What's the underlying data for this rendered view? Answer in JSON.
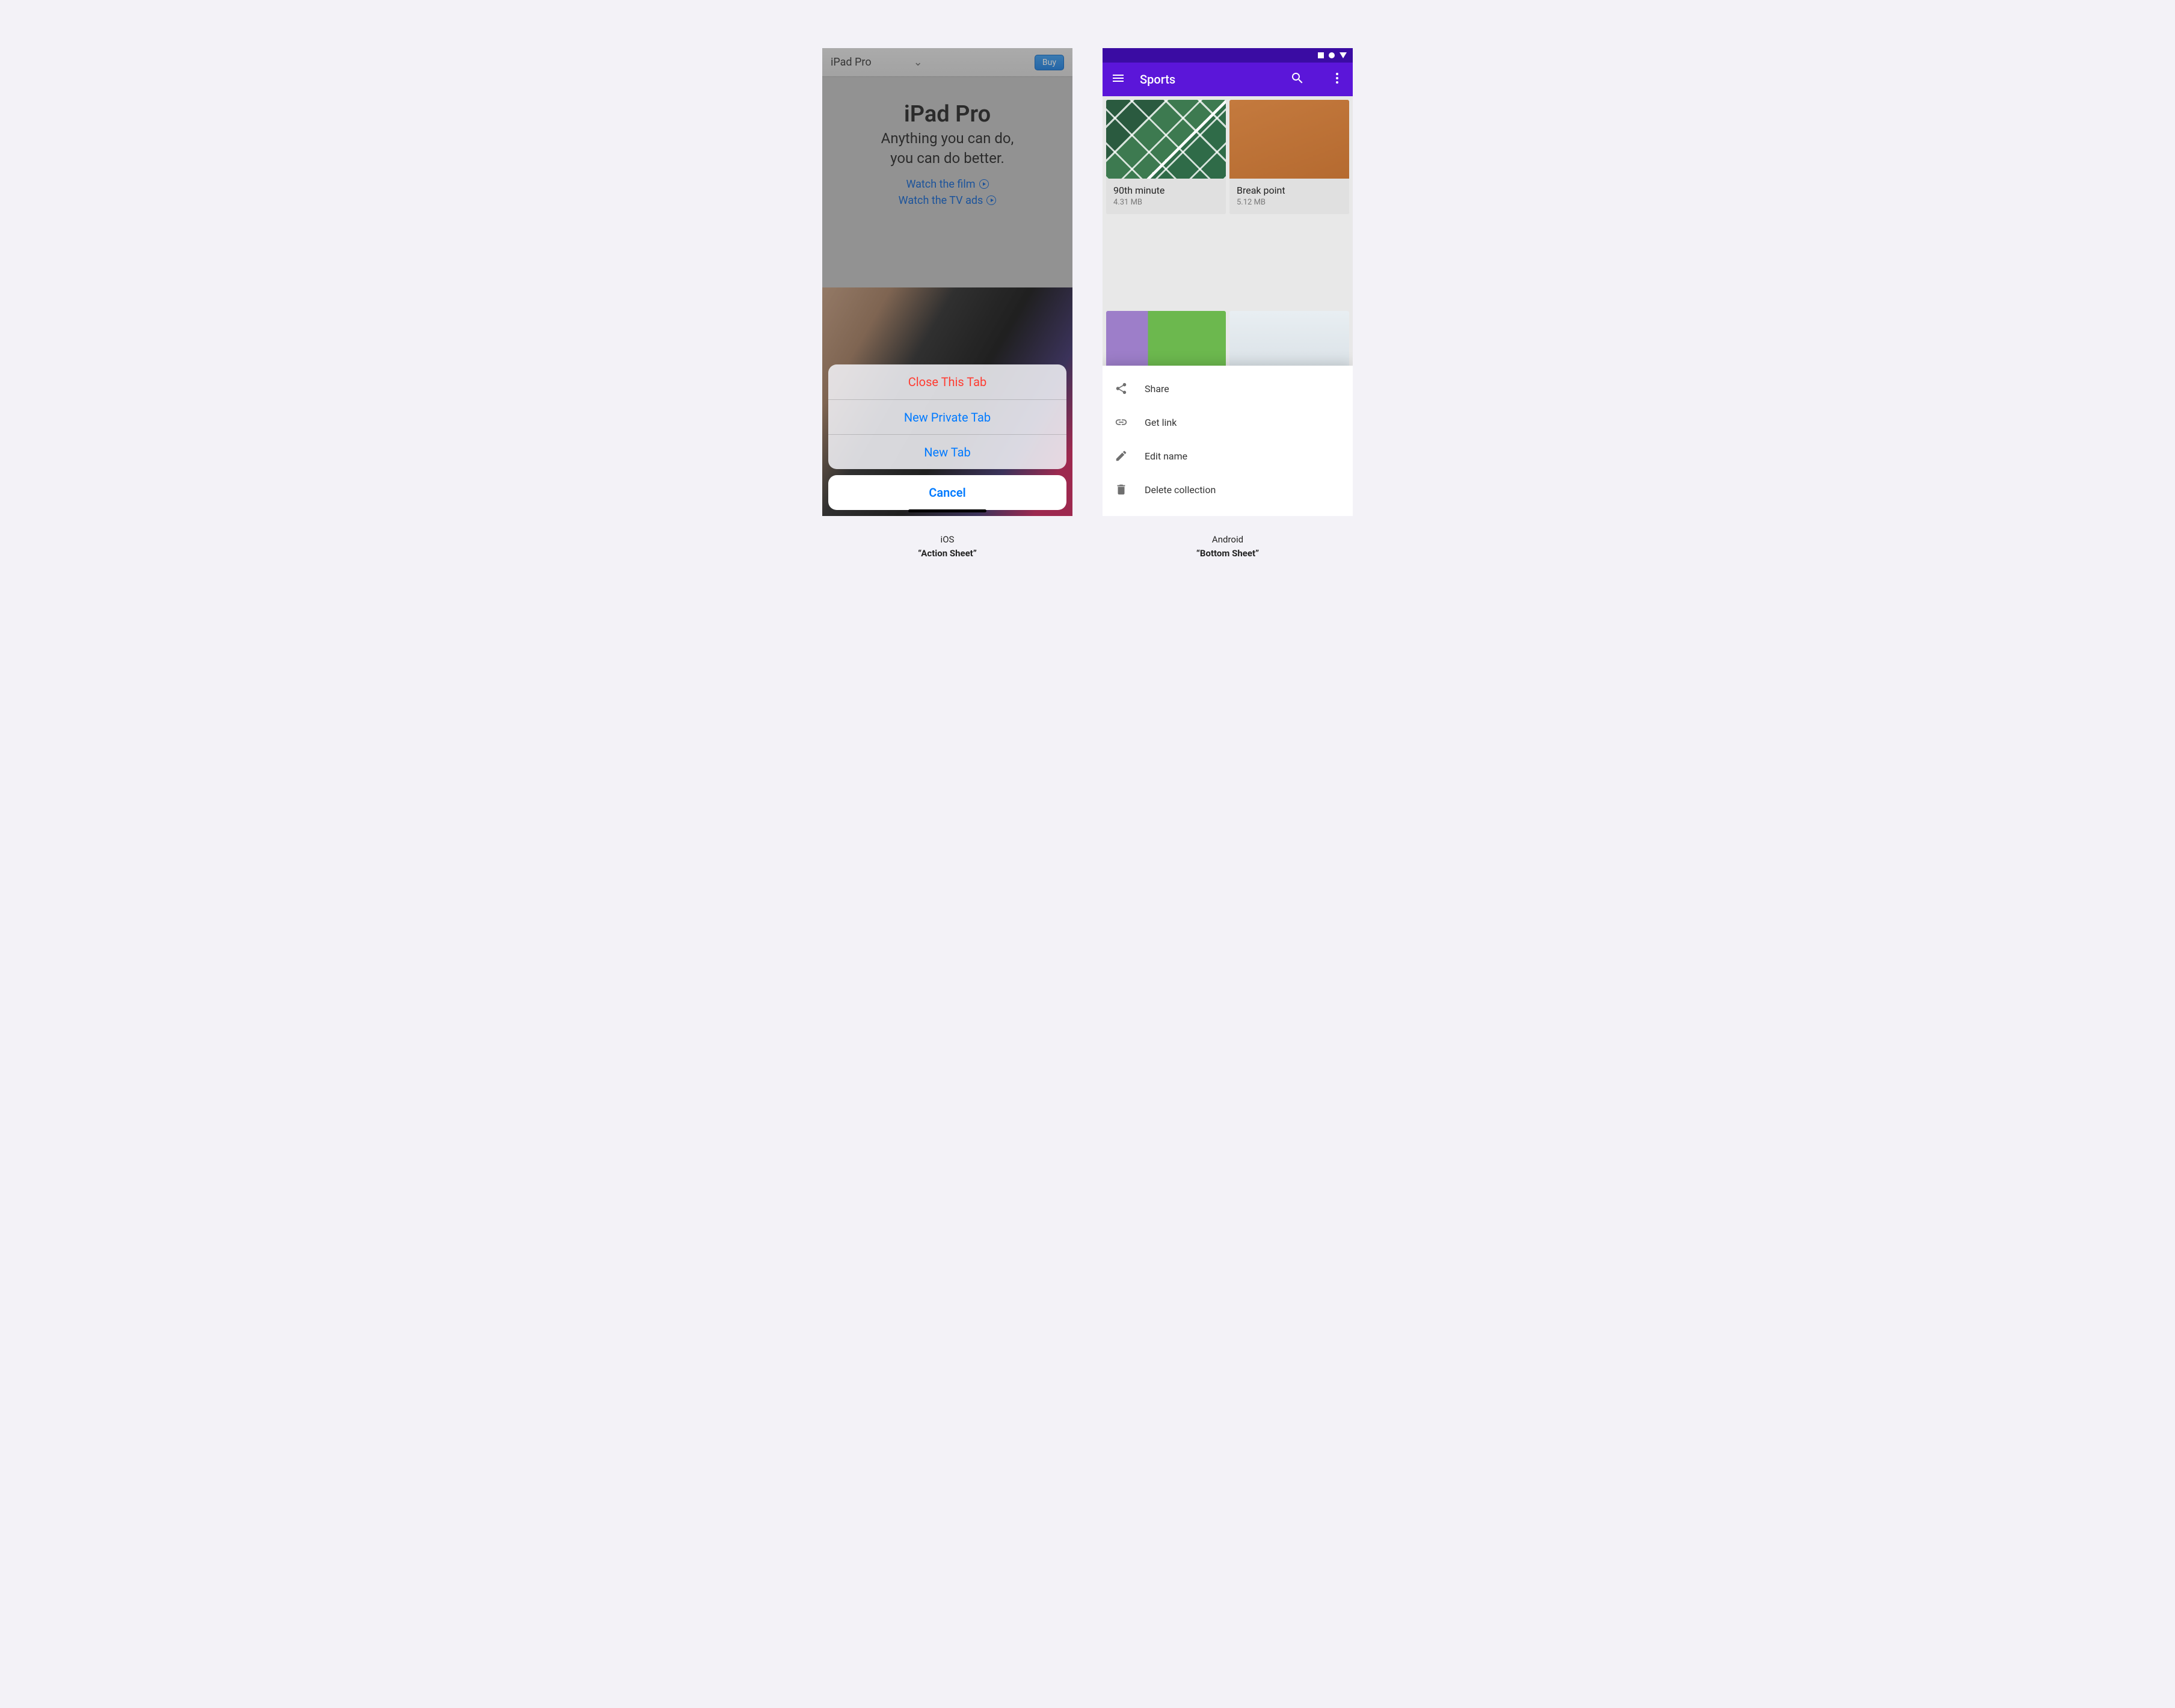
{
  "ios": {
    "topbar": {
      "title": "iPad Pro",
      "buy": "Buy"
    },
    "hero": {
      "headline": "iPad Pro",
      "subline1": "Anything you can do,",
      "subline2": "you can do better.",
      "link_film": "Watch the film",
      "link_ads": "Watch the TV ads"
    },
    "sheet": {
      "close_tab": "Close This Tab",
      "new_private": "New Private Tab",
      "new_tab": "New Tab",
      "cancel": "Cancel"
    },
    "caption_os": "iOS",
    "caption_name": "“Action Sheet”"
  },
  "android": {
    "appbar": {
      "title": "Sports"
    },
    "cards": [
      {
        "title": "90th minute",
        "size": "4.31 MB"
      },
      {
        "title": "Break point",
        "size": "5.12 MB"
      }
    ],
    "sheet": {
      "share": "Share",
      "get_link": "Get link",
      "edit_name": "Edit name",
      "delete": "Delete collection"
    },
    "caption_os": "Android",
    "caption_name": "“Bottom Sheet”"
  }
}
